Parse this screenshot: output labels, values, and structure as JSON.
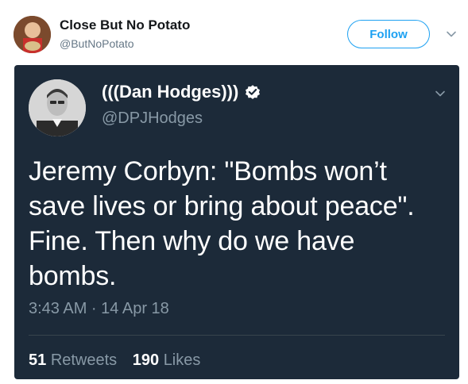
{
  "outer_tweet": {
    "display_name": "Close But No Potato",
    "handle": "@ButNoPotato",
    "follow_label": "Follow",
    "accent_color": "#1da1f2"
  },
  "screenshot_card": {
    "display_name": "(((Dan Hodges)))",
    "handle": "@DPJHodges",
    "text": "Jeremy Corbyn: \"Bombs won’t\nsave lives or bring about peace\".\nFine. Then why do we have\nbombs.",
    "timestamp": "3:43 AM · 14 Apr 18",
    "retweets_count": "51",
    "retweets_label": "Retweets",
    "likes_count": "190",
    "likes_label": "Likes",
    "background_color": "#1c2a39"
  },
  "icons": [
    "avatar",
    "verified-badge-icon",
    "chevron-down-icon"
  ]
}
